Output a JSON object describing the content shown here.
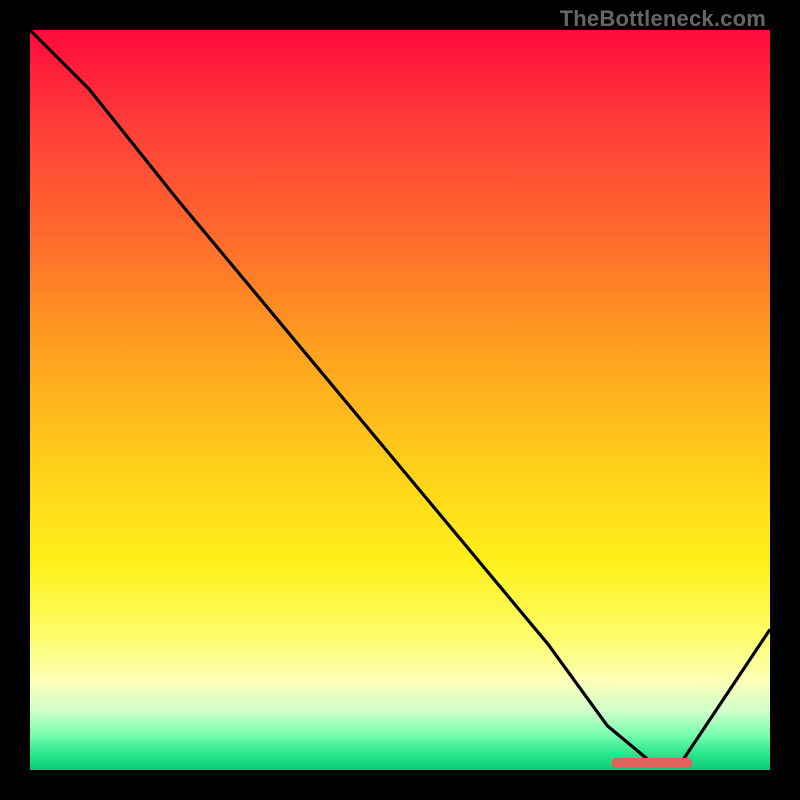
{
  "watermark": "TheBottleneck.com",
  "chart_data": {
    "type": "line",
    "title": "",
    "xlabel": "",
    "ylabel": "",
    "xlim": [
      0,
      100
    ],
    "ylim": [
      0,
      100
    ],
    "grid": false,
    "legend": false,
    "background_gradient": {
      "direction": "vertical",
      "stops": [
        {
          "pos": 0.0,
          "color": "#ff0a3c"
        },
        {
          "pos": 0.12,
          "color": "#ff3a3a"
        },
        {
          "pos": 0.28,
          "color": "#ff6b2c"
        },
        {
          "pos": 0.45,
          "color": "#ffa61f"
        },
        {
          "pos": 0.6,
          "color": "#ffd21a"
        },
        {
          "pos": 0.72,
          "color": "#fff01a"
        },
        {
          "pos": 0.82,
          "color": "#fdfd6b"
        },
        {
          "pos": 0.88,
          "color": "#fbffb8"
        },
        {
          "pos": 0.92,
          "color": "#d2ffca"
        },
        {
          "pos": 0.95,
          "color": "#7dffaf"
        },
        {
          "pos": 0.98,
          "color": "#25e58b"
        },
        {
          "pos": 1.0,
          "color": "#0dca75"
        }
      ]
    },
    "series": [
      {
        "name": "curve",
        "color": "#000000",
        "x": [
          0,
          8,
          20,
          30,
          40,
          50,
          60,
          70,
          78,
          84,
          88,
          100
        ],
        "values": [
          100,
          92,
          77,
          65,
          53,
          41,
          29,
          17,
          6,
          1,
          1,
          19
        ]
      }
    ],
    "marker": {
      "name": "highlight",
      "color": "#e0625f",
      "shape": "rounded-bar",
      "x_center": 84,
      "y": 1,
      "width_x_units": 11
    }
  }
}
